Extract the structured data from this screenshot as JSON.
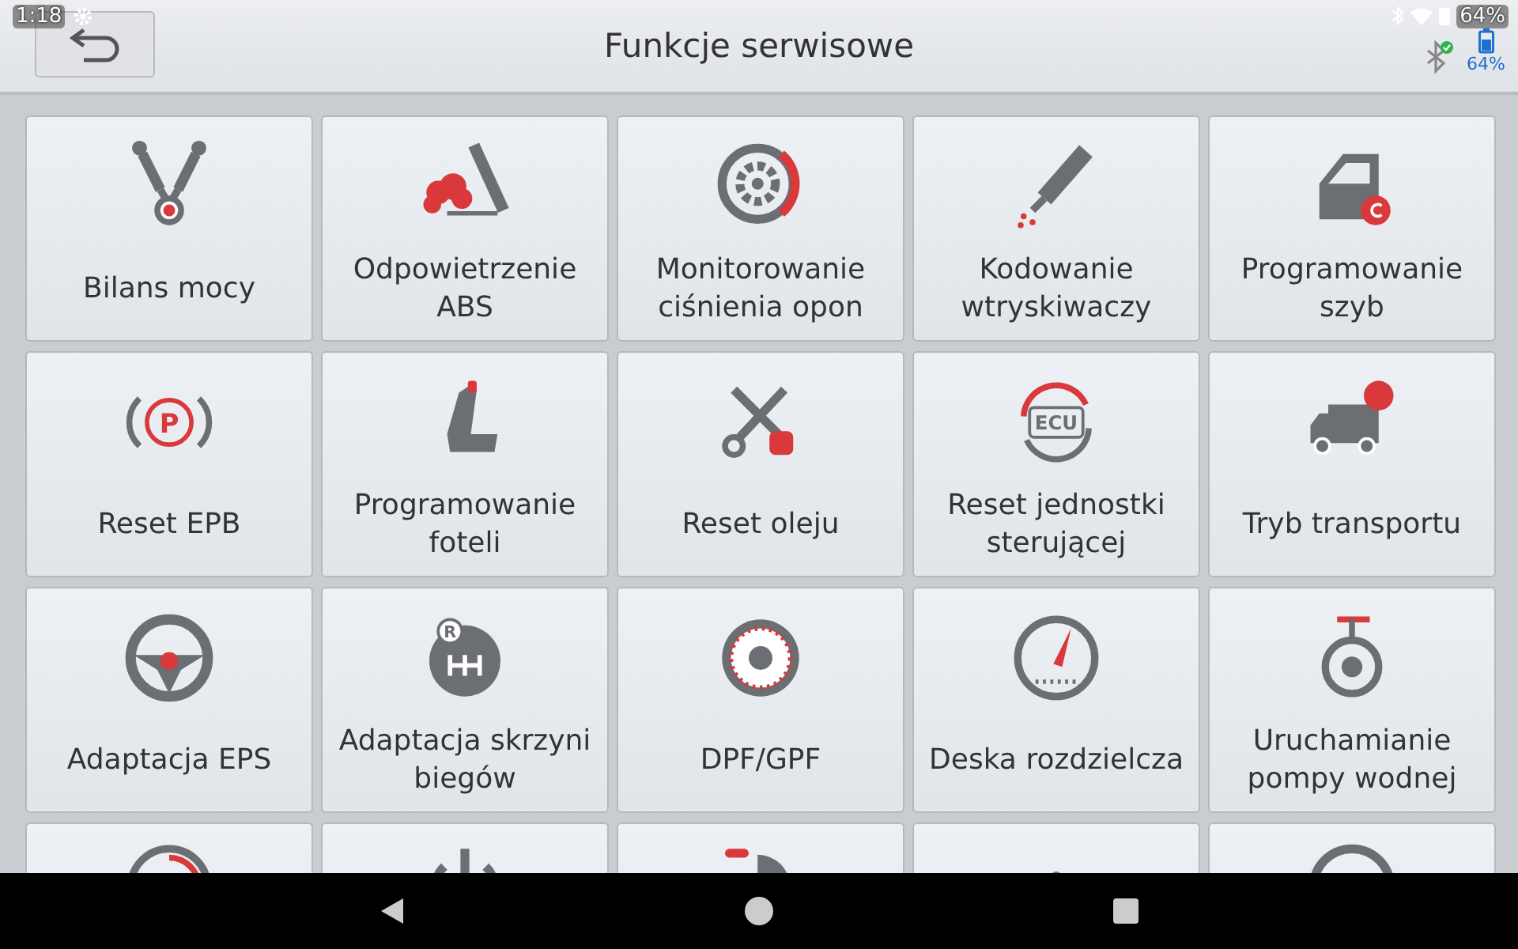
{
  "status_bar": {
    "time": "1:18",
    "battery": "64%"
  },
  "header": {
    "title": "Funkcje serwisowe",
    "battery": "64%"
  },
  "tiles": [
    {
      "kind": "full",
      "label": "Bilans mocy"
    },
    {
      "kind": "full",
      "label": "Odpowietrzenie ABS"
    },
    {
      "kind": "full",
      "label": "Monitorowanie ciśnienia opon"
    },
    {
      "kind": "full",
      "label": "Kodowanie wtryskiwaczy"
    },
    {
      "kind": "full",
      "label": "Programowanie szyb"
    },
    {
      "kind": "full",
      "label": "Reset EPB",
      "icon_text": "P"
    },
    {
      "kind": "full",
      "label": "Programowanie foteli"
    },
    {
      "kind": "full",
      "label": "Reset oleju"
    },
    {
      "kind": "full",
      "label": "Reset jednostki sterującej",
      "icon_text": "ECU"
    },
    {
      "kind": "full",
      "label": "Tryb transportu"
    },
    {
      "kind": "full",
      "label": "Adaptacja EPS"
    },
    {
      "kind": "full",
      "label": "Adaptacja skrzyni biegów",
      "icon_text": "R"
    },
    {
      "kind": "full",
      "label": "DPF/GPF"
    },
    {
      "kind": "full",
      "label": "Deska rozdzielcza"
    },
    {
      "kind": "full",
      "label": "Uruchamianie pompy wodnej"
    },
    {
      "kind": "cut"
    },
    {
      "kind": "cut"
    },
    {
      "kind": "cut"
    },
    {
      "kind": "cut"
    },
    {
      "kind": "cut"
    }
  ]
}
